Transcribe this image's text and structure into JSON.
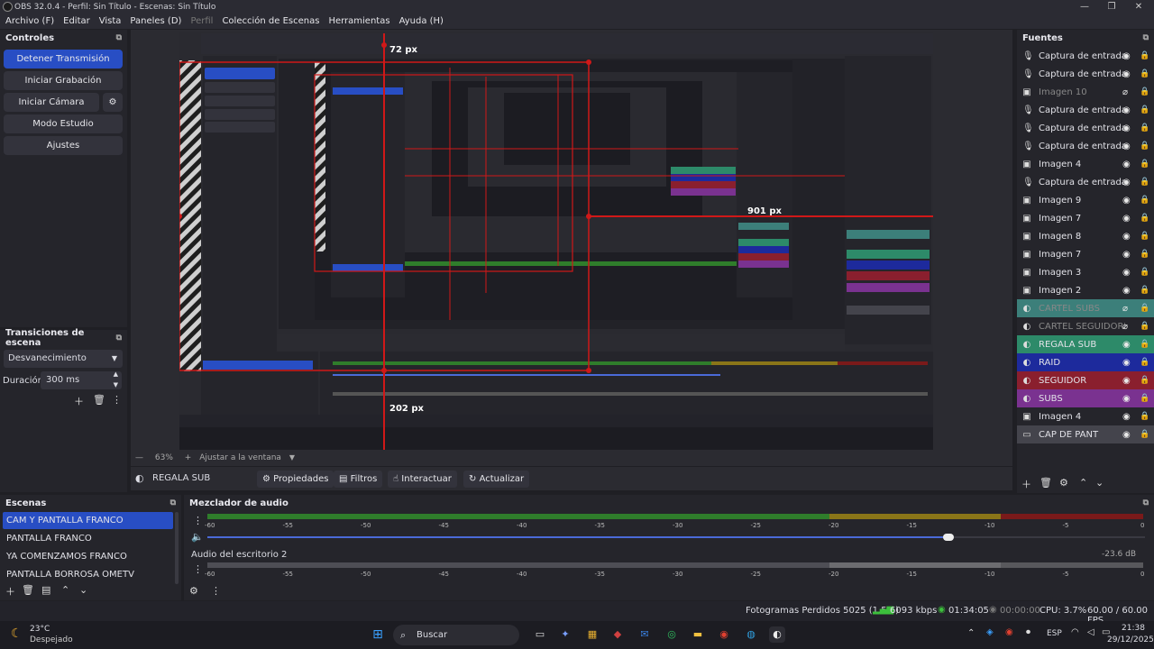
{
  "window": {
    "title": "OBS 32.0.4 - Perfil: Sin Título - Escenas: Sin Título"
  },
  "menu": {
    "items": [
      "Archivo (F)",
      "Editar",
      "Vista",
      "Paneles (D)",
      "Perfil",
      "Colección de Escenas",
      "Herramientas",
      "Ayuda (H)"
    ]
  },
  "controls": {
    "title": "Controles",
    "stop_stream": "Detener Transmisión",
    "start_record": "Iniciar Grabación",
    "virtual_cam": "Iniciar Cámara Virtual",
    "studio_mode": "Modo Estudio",
    "settings": "Ajustes"
  },
  "transitions": {
    "title": "Transiciones de escena",
    "selected": "Desvanecimiento",
    "duration_label": "Duración",
    "duration_value": "300 ms"
  },
  "preview": {
    "zoom": "63%",
    "zoom_option": "Ajustar a la ventana",
    "label_top": "72 px",
    "label_right": "901 px",
    "label_bottom": "202 px"
  },
  "source_bar": {
    "selected": "REGALA SUB",
    "properties": "Propiedades",
    "filters": "Filtros",
    "interact": "Interactuar",
    "refresh": "Actualizar"
  },
  "sources": {
    "title": "Fuentes",
    "items": [
      {
        "name": "Captura de entrada auc",
        "icon": "mic-icon",
        "color": "",
        "dim": false
      },
      {
        "name": "Captura de entrada auc",
        "icon": "mic-icon",
        "color": "",
        "dim": false
      },
      {
        "name": "Imagen 10",
        "icon": "image-icon",
        "color": "",
        "dim": true
      },
      {
        "name": "Captura de entrada auc",
        "icon": "mic-icon",
        "color": "",
        "dim": false
      },
      {
        "name": "Captura de entrada auc",
        "icon": "mic-icon",
        "color": "",
        "dim": false
      },
      {
        "name": "Captura de entrada auc",
        "icon": "mic-icon",
        "color": "",
        "dim": false
      },
      {
        "name": "Imagen 4",
        "icon": "image-icon",
        "color": "",
        "dim": false
      },
      {
        "name": "Captura de entrada auc",
        "icon": "mic-icon",
        "color": "",
        "dim": false
      },
      {
        "name": "Imagen 9",
        "icon": "image-icon",
        "color": "",
        "dim": false
      },
      {
        "name": "Imagen 7",
        "icon": "image-icon",
        "color": "",
        "dim": false
      },
      {
        "name": "Imagen 8",
        "icon": "image-icon",
        "color": "",
        "dim": false
      },
      {
        "name": "Imagen 7",
        "icon": "image-icon",
        "color": "",
        "dim": false
      },
      {
        "name": "Imagen 3",
        "icon": "image-icon",
        "color": "",
        "dim": false
      },
      {
        "name": "Imagen 2",
        "icon": "image-icon",
        "color": "",
        "dim": false
      },
      {
        "name": "CARTEL SUBS",
        "icon": "browser-icon",
        "color": "#3c7f7a",
        "dim": true
      },
      {
        "name": "CARTEL SEGUIDORES",
        "icon": "browser-icon",
        "color": "",
        "dim": true
      },
      {
        "name": "REGALA SUB",
        "icon": "browser-icon",
        "color": "#2d8a69",
        "dim": false
      },
      {
        "name": "RAID",
        "icon": "browser-icon",
        "color": "#1d2a9c",
        "dim": false
      },
      {
        "name": "SEGUIDOR",
        "icon": "browser-icon",
        "color": "#8a1f2e",
        "dim": false
      },
      {
        "name": "SUBS",
        "icon": "browser-icon",
        "color": "#7a3290",
        "dim": false
      },
      {
        "name": "Imagen 4",
        "icon": "image-icon",
        "color": "",
        "dim": false
      },
      {
        "name": "CAP DE PANT",
        "icon": "monitor-icon",
        "color": "#44444c",
        "dim": false
      }
    ]
  },
  "scenes": {
    "title": "Escenas",
    "items": [
      "CAM Y PANTALLA FRANCO",
      "PANTALLA FRANCO",
      "YA COMENZAMOS FRANCO",
      "PANTALLA BORROSA OMETV"
    ]
  },
  "mixer": {
    "title": "Mezclador de audio",
    "ticks": [
      "-60",
      "-55",
      "-50",
      "-45",
      "-40",
      "-35",
      "-30",
      "-25",
      "-20",
      "-15",
      "-10",
      "-5",
      "0"
    ],
    "tracks": [
      {
        "name": "",
        "db": "",
        "volume": 0.79
      },
      {
        "name": "Audio del escritorio 2",
        "db": "-23.6 dB",
        "volume": 0
      }
    ]
  },
  "status": {
    "dropped": "Fotogramas Perdidos 5025 (1.5%)",
    "bitrate": "6093 kbps",
    "live_time": "01:34:05",
    "rec_time": "00:00:00",
    "cpu": "CPU: 3.7%",
    "fps": "60.00 / 60.00 FPS"
  },
  "taskbar": {
    "temp": "23°C",
    "weather": "Despejado",
    "search": "Buscar",
    "lang": "ESP",
    "time": "21:38",
    "date": "29/12/2025"
  },
  "colors": {
    "accent": "#284ec4",
    "meter_green": "#2f7d2b",
    "meter_yellow": "#8a7518",
    "meter_red": "#7a1a1a",
    "guide_red": "#d01818"
  }
}
